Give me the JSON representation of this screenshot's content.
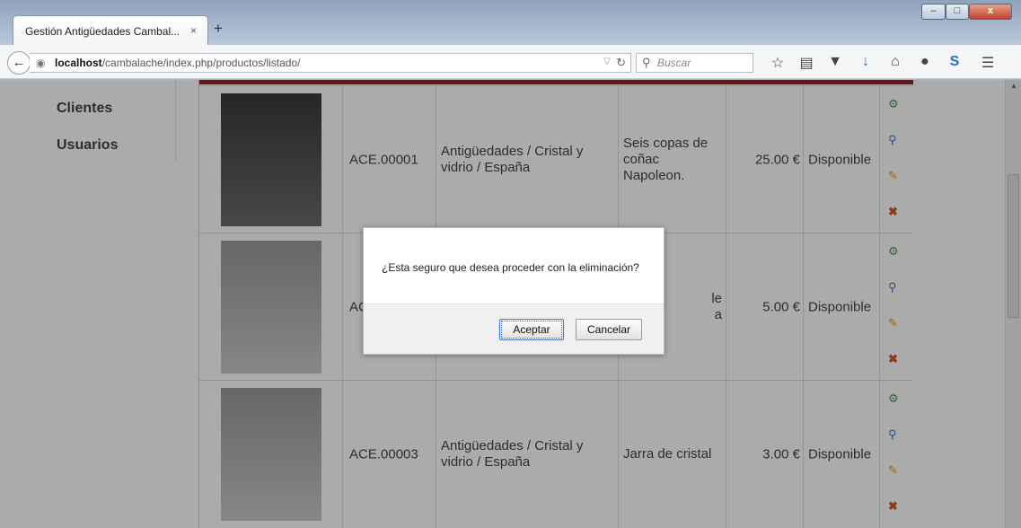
{
  "browser": {
    "tab_title": "Gestión Antigüedades Cambal...",
    "tab_close": "×",
    "new_tab": "+",
    "url_host": "localhost",
    "url_path": "/cambalache/index.php/productos/listado/",
    "search_placeholder": "Buscar",
    "window_controls": [
      "–",
      "□",
      "x"
    ]
  },
  "sidebar": {
    "items": [
      {
        "label": "Clientes"
      },
      {
        "label": "Usuarios"
      }
    ]
  },
  "products": [
    {
      "code": "ACE.00001",
      "category": "Antigüedades  /  Cristal y vidrio  /  España",
      "name": "Seis copas de coñac Napoleon.",
      "price": "25.00 €",
      "status": "Disponible"
    },
    {
      "code": "AC",
      "category": "",
      "name": "le\na",
      "price": "5.00 €",
      "status": "Disponible"
    },
    {
      "code": "ACE.00003",
      "category": "Antigüedades  /  Cristal y vidrio  /  España",
      "name": "Jarra de cristal",
      "price": "3.00 €",
      "status": "Disponible"
    }
  ],
  "dialog": {
    "message": "¿Esta seguro que desea proceder con la eliminación?",
    "accept_label": "Aceptar",
    "cancel_label": "Cancelar"
  },
  "icons": {
    "back": "back-arrow-icon",
    "actions": [
      "image-gear-icon",
      "zoom-icon",
      "edit-pencil-icon",
      "delete-x-icon"
    ]
  },
  "colors": {
    "header_red": "#9b1c1c",
    "delete_orange": "#d9541e",
    "edit_yellow": "#d4a017",
    "zoom_blue": "#3b7bbf"
  }
}
